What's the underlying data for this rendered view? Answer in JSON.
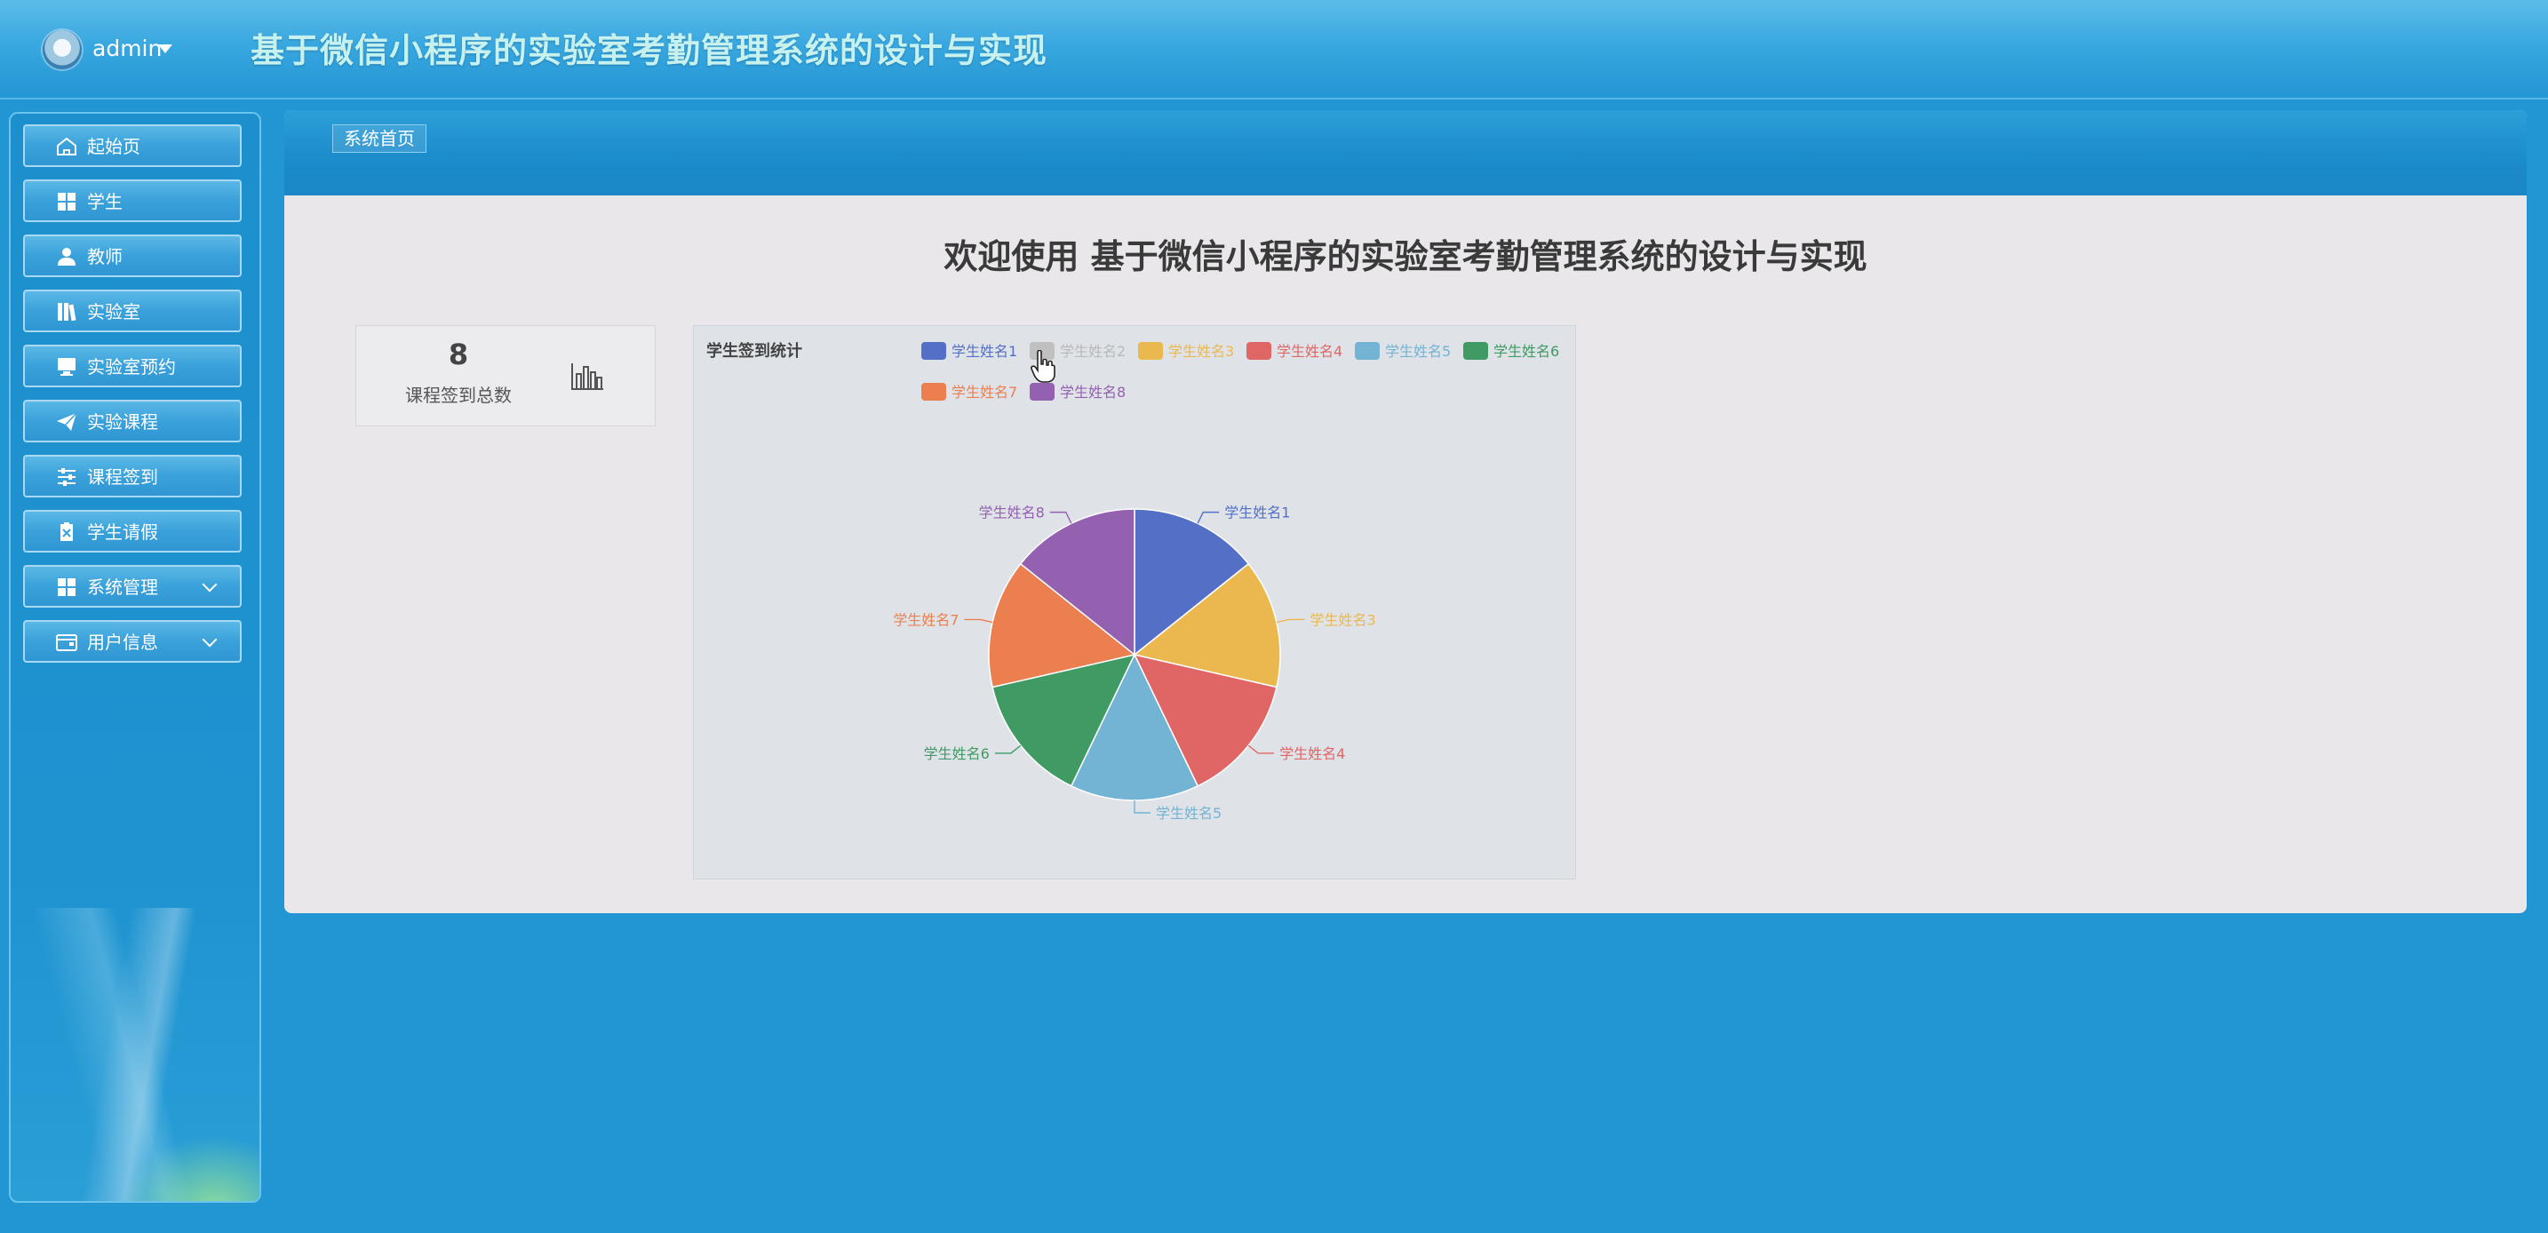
{
  "header": {
    "user": "admin",
    "title": "基于微信小程序的实验室考勤管理系统的设计与实现"
  },
  "sidebar": {
    "items": [
      {
        "label": "起始页",
        "icon": "home-icon",
        "expandable": false
      },
      {
        "label": "学生",
        "icon": "grid-icon",
        "expandable": false
      },
      {
        "label": "教师",
        "icon": "user-icon",
        "expandable": false
      },
      {
        "label": "实验室",
        "icon": "book-icon",
        "expandable": false
      },
      {
        "label": "实验室预约",
        "icon": "monitor-icon",
        "expandable": false
      },
      {
        "label": "实验课程",
        "icon": "paper-plane-icon",
        "expandable": false
      },
      {
        "label": "课程签到",
        "icon": "sliders-icon",
        "expandable": false
      },
      {
        "label": "学生请假",
        "icon": "clipboard-icon",
        "expandable": false
      },
      {
        "label": "系统管理",
        "icon": "grid-icon",
        "expandable": true
      },
      {
        "label": "用户信息",
        "icon": "wallet-icon",
        "expandable": true
      }
    ]
  },
  "breadcrumb": "系统首页",
  "welcome": "欢迎使用 基于微信小程序的实验室考勤管理系统的设计与实现",
  "stat": {
    "value": "8",
    "label": "课程签到总数",
    "icon": "bar-chart-icon"
  },
  "chart_data": {
    "type": "pie",
    "title": "学生签到统计",
    "legend_position": "top",
    "series": [
      {
        "name": "学生姓名1",
        "value": 1,
        "color": "#5470c6",
        "visible": true
      },
      {
        "name": "学生姓名2",
        "value": 1,
        "color": "#c0c0c0",
        "visible": false
      },
      {
        "name": "学生姓名3",
        "value": 1,
        "color": "#eab84e",
        "visible": true
      },
      {
        "name": "学生姓名4",
        "value": 1,
        "color": "#e06666",
        "visible": true
      },
      {
        "name": "学生姓名5",
        "value": 1,
        "color": "#73b3d3",
        "visible": true
      },
      {
        "name": "学生姓名6",
        "value": 1,
        "color": "#3f9a63",
        "visible": true
      },
      {
        "name": "学生姓名7",
        "value": 1,
        "color": "#ec7f4f",
        "visible": true
      },
      {
        "name": "学生姓名8",
        "value": 1,
        "color": "#9460b0",
        "visible": true
      }
    ]
  }
}
